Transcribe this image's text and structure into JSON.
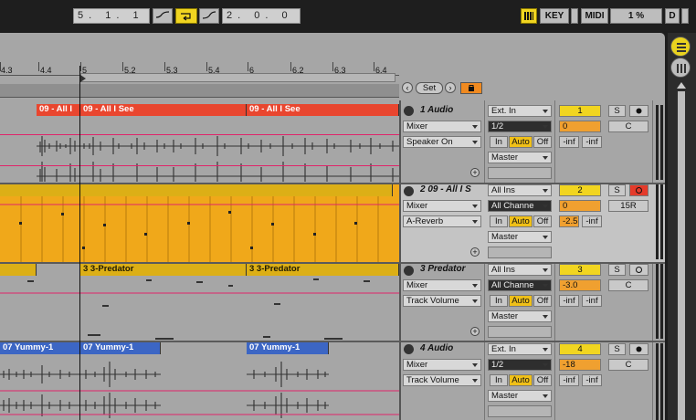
{
  "transport": {
    "position": "5. 1. 1",
    "loop_length": "2. 0. 0",
    "key_label": "KEY",
    "midi_label": "MIDI",
    "cpu": "1 %",
    "d_label": "D"
  },
  "ruler": {
    "ticks": [
      "4.3",
      "4.4",
      "5",
      "5.2",
      "5.3",
      "5.4",
      "6",
      "6.2",
      "6.3",
      "6.4"
    ],
    "set_label": "Set"
  },
  "tracks": [
    {
      "name": "1 Audio",
      "clips": [
        "09 - All I",
        "09 - All I See",
        "09 - All I See"
      ],
      "input": "Ext. In",
      "channel": "1/2",
      "device": "Mixer",
      "automation": "Speaker On",
      "monitor": [
        "In",
        "Auto",
        "Off"
      ],
      "output": "Master",
      "number": "1",
      "volume": "0",
      "pan": "C",
      "meter_left": "-inf",
      "meter_right": "-inf",
      "solo": "S"
    },
    {
      "name": "2 09 - All I S",
      "input": "All Ins",
      "channel": "All Channe",
      "device": "Mixer",
      "automation": "A-Reverb",
      "monitor": [
        "In",
        "Auto",
        "Off"
      ],
      "output": "Master",
      "number": "2",
      "volume": "0",
      "pan": "15R",
      "meter_left": "-2.5",
      "meter_right": "-inf",
      "solo": "S"
    },
    {
      "name": "3 Predator",
      "clips": [
        "3 3-Predator",
        "3 3-Predator"
      ],
      "input": "All Ins",
      "channel": "All Channe",
      "device": "Mixer",
      "automation": "Track Volume",
      "monitor": [
        "In",
        "Auto",
        "Off"
      ],
      "output": "Master",
      "number": "3",
      "volume": "-3.0",
      "pan": "C",
      "meter_left": "-inf",
      "meter_right": "-inf",
      "solo": "S"
    },
    {
      "name": "4 Audio",
      "clips": [
        "07 Yummy-1",
        "07 Yummy-1",
        "07 Yummy-1"
      ],
      "input": "Ext. In",
      "channel": "1/2",
      "device": "Mixer",
      "automation": "Track Volume",
      "monitor": [
        "In",
        "Auto",
        "Off"
      ],
      "output": "Master",
      "number": "4",
      "volume": "-18",
      "pan": "C",
      "meter_left": "-inf",
      "meter_right": "-inf",
      "solo": "S"
    }
  ],
  "colors": {
    "clip_red": "#e9462f",
    "clip_yellow": "#dcaf16",
    "clip_blue": "#3c66c4",
    "automation_line": "#e0246a",
    "accent_yellow": "#f1d520"
  }
}
